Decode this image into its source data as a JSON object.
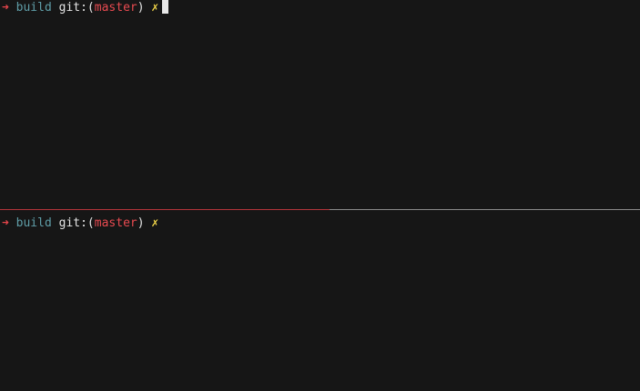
{
  "colors": {
    "background": "#161616",
    "arrow": "#e6454b",
    "directory": "#5f9ea8",
    "git_label": "#e6e6e6",
    "branch": "#e84a50",
    "dirty_marker": "#f2d649",
    "active_divider": "#b3343a",
    "inactive_divider": "#8a8a8a"
  },
  "panes": [
    {
      "prompt": {
        "arrow": "➜",
        "directory": "build",
        "git_prefix": "git:(",
        "branch": "master",
        "git_suffix": ")",
        "dirty_marker": "✗"
      },
      "cursor_visible": true
    },
    {
      "prompt": {
        "arrow": "➜",
        "directory": "build",
        "git_prefix": "git:(",
        "branch": "master",
        "git_suffix": ")",
        "dirty_marker": "✗"
      },
      "cursor_visible": false
    }
  ]
}
